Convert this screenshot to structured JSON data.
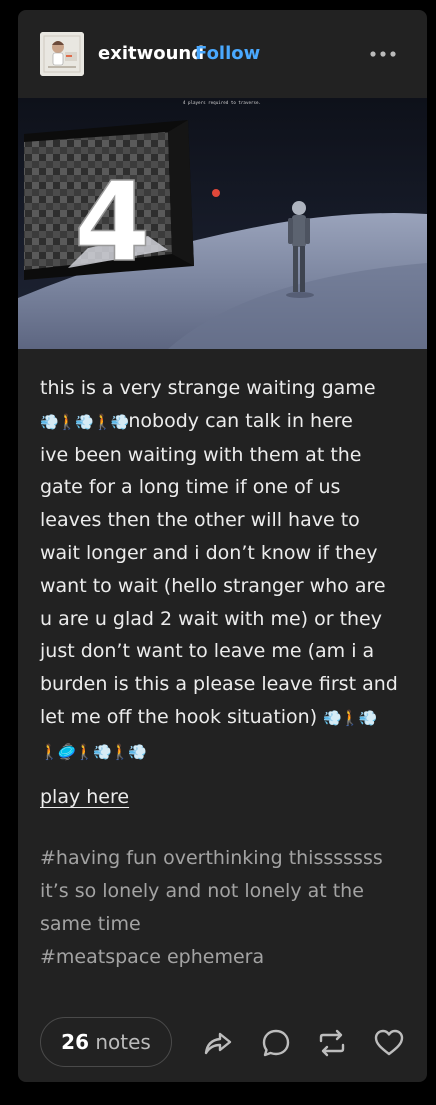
{
  "post": {
    "username": "exitwound",
    "follow_label": "Follow",
    "image": {
      "hud_text": "4 players required to traverse.",
      "gate_number": "4"
    },
    "body": {
      "l1": "this is a very strange waiting game",
      "l2_emoji": "💨🚶💨🚶💨",
      "l2_text": "nobody can talk in here",
      "l3": "ive been waiting with them at the",
      "l4": "gate for a long time if one of us",
      "l5": "leaves then the other will have to",
      "l6": "wait longer and i don’t know if they",
      "l7": "want to wait (hello stranger who are",
      "l8": "u are u glad 2 wait with me) or they",
      "l9": "just don’t want to leave me (am i a",
      "l10": "burden is this a please leave first and",
      "l11_text": "let me off the hook situation)",
      "l11_emoji": "💨🚶💨",
      "l12_emoji": "🚶🥏🚶💨🚶💨"
    },
    "link_label": "play here",
    "tags": [
      "#having fun overthinking thisssssss",
      "it’s so lonely and not lonely at the same time",
      "#meatspace ephemera"
    ],
    "notes": {
      "count": "26",
      "label": "notes"
    },
    "colors": {
      "card": "#222222",
      "follow": "#4aa9ff",
      "tag": "#a3a3a3",
      "page": "#000000"
    }
  }
}
